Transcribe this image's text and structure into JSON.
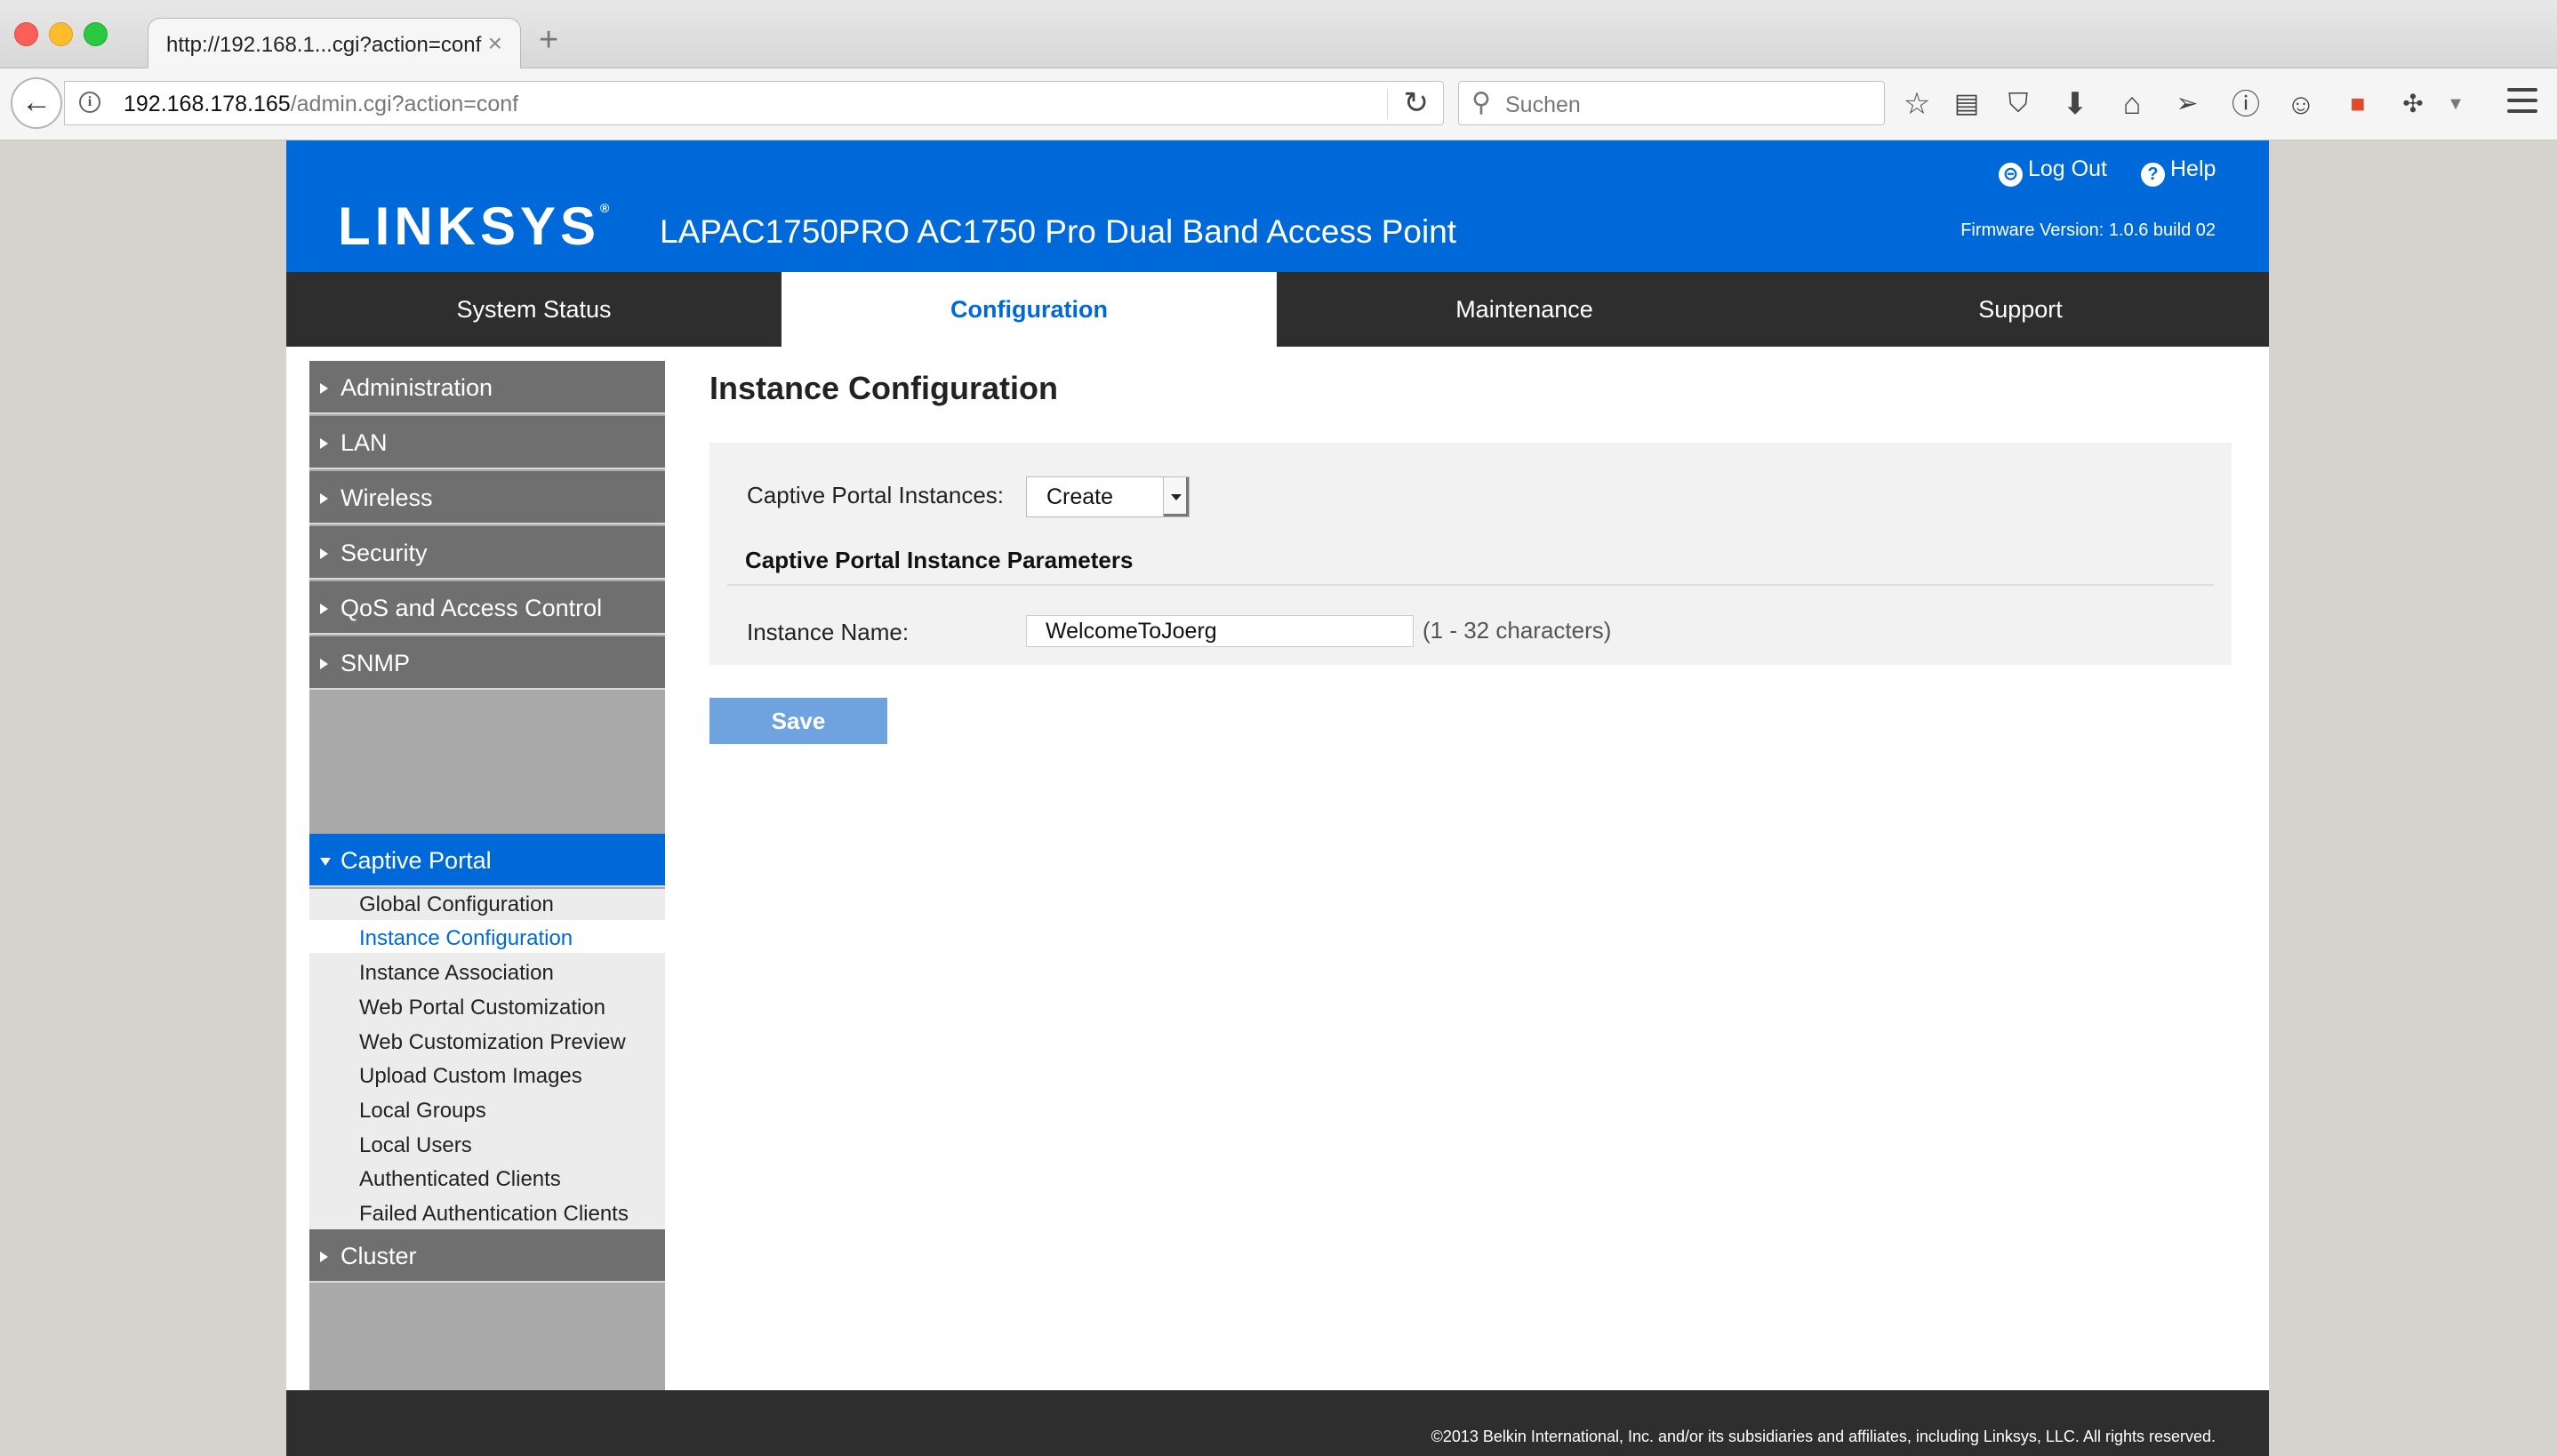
{
  "browser": {
    "tab_title": "http://192.168.1...cgi?action=conf",
    "tab_close": "×",
    "new_tab": "+",
    "url_host": "192.168.178.165",
    "url_path": "/admin.cgi?action=conf",
    "search_placeholder": "Suchen",
    "toolbar_icons": [
      "bookmark-star-icon",
      "reading-list-icon",
      "pocket-icon",
      "download-icon",
      "home-icon",
      "send-icon",
      "info-circle-icon",
      "chat-icon",
      "extension-icon",
      "puzzle-icon"
    ]
  },
  "header": {
    "logo": "LINKSYS",
    "logo_mark": "®",
    "product": "LAPAC1750PRO AC1750 Pro Dual Band Access Point",
    "logout": "Log Out",
    "help": "Help",
    "firmware": "Firmware Version: 1.0.6 build 02"
  },
  "topnav": [
    {
      "label": "System Status"
    },
    {
      "label": "Configuration"
    },
    {
      "label": "Maintenance"
    },
    {
      "label": "Support"
    }
  ],
  "sidebar": {
    "menus": [
      {
        "label": "Administration"
      },
      {
        "label": "LAN"
      },
      {
        "label": "Wireless"
      },
      {
        "label": "Security"
      },
      {
        "label": "QoS and Access Control"
      },
      {
        "label": "SNMP"
      },
      {
        "label": "Captive Portal"
      },
      {
        "label": "Cluster"
      }
    ],
    "captive_portal_items": [
      {
        "label": "Global Configuration"
      },
      {
        "label": "Instance Configuration"
      },
      {
        "label": "Instance Association"
      },
      {
        "label": "Web Portal Customization"
      },
      {
        "label": "Web Customization Preview"
      },
      {
        "label": "Upload Custom Images"
      },
      {
        "label": "Local Groups"
      },
      {
        "label": "Local Users"
      },
      {
        "label": "Authenticated Clients"
      },
      {
        "label": "Failed Authentication Clients"
      }
    ]
  },
  "content": {
    "title": "Instance Configuration",
    "instances_label": "Captive Portal Instances:",
    "instances_value": "Create",
    "section_title": "Captive Portal Instance Parameters",
    "instance_name_label": "Instance Name:",
    "instance_name_value": "WelcomeToJoerg",
    "instance_name_hint": "(1 - 32 characters)",
    "save_label": "Save"
  },
  "footer": {
    "copyright": "©2013 Belkin International, Inc. and/or its subsidiaries and affiliates, including Linksys, LLC. All rights reserved."
  },
  "colors": {
    "brand_blue": "#0069d9",
    "nav_dark": "#2e2e2e",
    "menu_gray": "#6f6f6f",
    "save_button": "#6ea3df"
  }
}
